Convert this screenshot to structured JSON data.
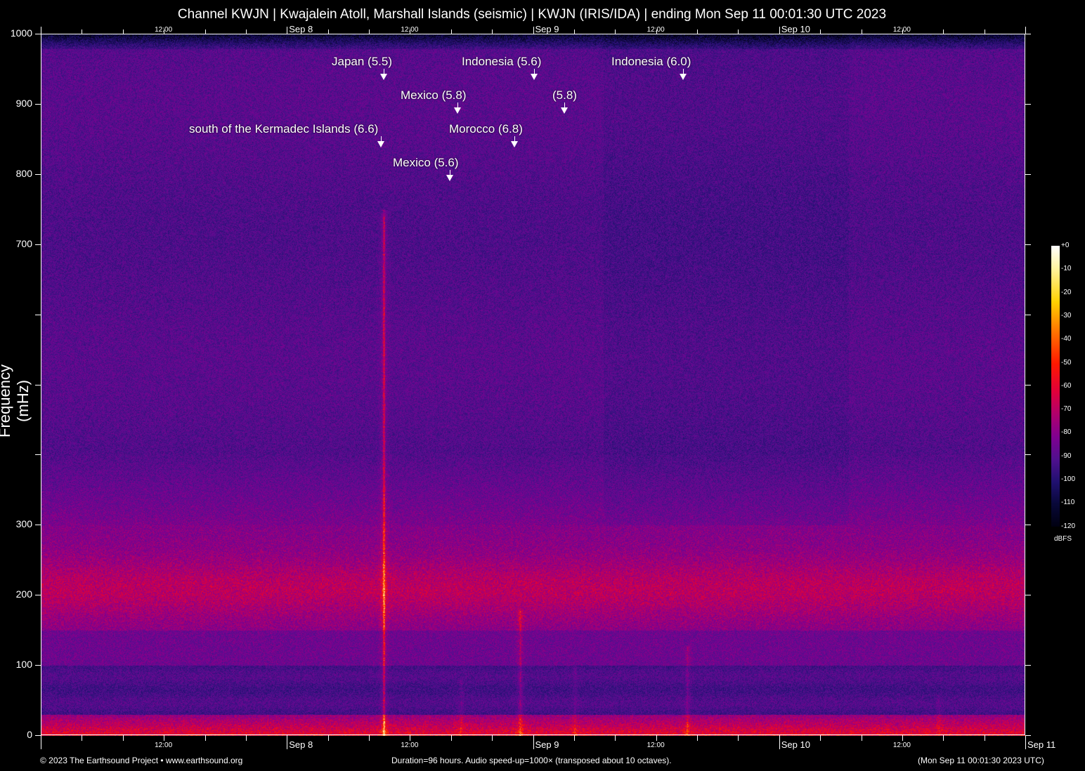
{
  "title": "Channel KWJN | Kwajalein Atoll, Marshall Islands (seismic) | KWJN (IRIS/IDA) | ending Mon Sep 11 00:01:30 UTC 2023",
  "chart_data": {
    "type": "heatmap",
    "title": "Channel KWJN | Kwajalein Atoll, Marshall Islands (seismic) | KWJN (IRIS/IDA) | ending Mon Sep 11 00:01:30 UTC 2023",
    "ylabel": "Frequency (mHz)",
    "ylim": [
      0,
      1000
    ],
    "y_ticks": [
      "1000",
      "900",
      "800",
      "700",
      "300",
      "200",
      "100",
      "0"
    ],
    "x_ticks_top": [
      "12:00",
      "Sep  8",
      "12:00",
      "Sep  9",
      "12:00",
      "Sep 10",
      "12:00"
    ],
    "x_ticks_bottom": [
      "12:00",
      "Sep  8",
      "12:00",
      "Sep  9",
      "12:00",
      "Sep 10",
      "12:00",
      "Sep 11"
    ],
    "duration_hours": 96,
    "colorbar": {
      "label": "dBFS",
      "ticks": [
        "+0",
        "-10",
        "-20",
        "-30",
        "-40",
        "-50",
        "-60",
        "-70",
        "-80",
        "-90",
        "-100",
        "-110",
        "-120"
      ],
      "range": [
        -120,
        0
      ]
    },
    "events": [
      {
        "label": "Japan (5.5)"
      },
      {
        "label": "Indonesia (5.6)"
      },
      {
        "label": "Indonesia (6.0)"
      },
      {
        "label": "Mexico (5.8)"
      },
      {
        "label": "(5.8)"
      },
      {
        "label": "south of the Kermadec Islands (6.6)"
      },
      {
        "label": "Morocco (6.8)"
      },
      {
        "label": "Mexico (5.6)"
      }
    ]
  },
  "footer": {
    "left": "© 2023 The Earthsound Project • www.earthsound.org",
    "center": "Duration=96 hours. Audio speed-up=1000× (transposed about 10 octaves).",
    "right": "(Mon Sep 11 00:01:30 2023 UTC)"
  }
}
